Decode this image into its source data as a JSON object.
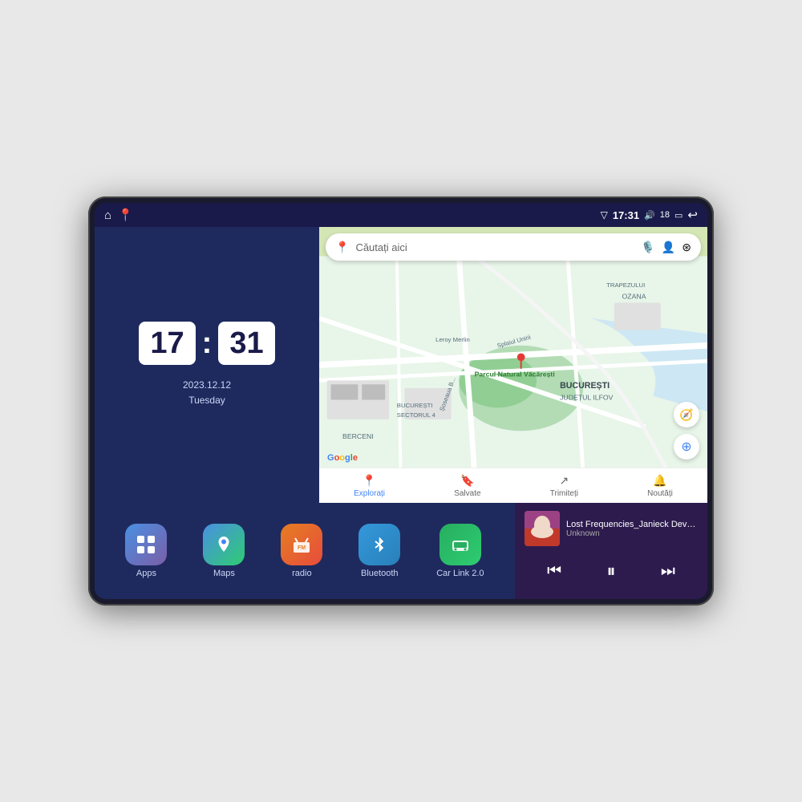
{
  "device": {
    "status_bar": {
      "left_icons": [
        "home-icon",
        "maps-pin-icon"
      ],
      "time": "17:31",
      "volume_icon": "volume-icon",
      "volume_level": "18",
      "battery_icon": "battery-icon",
      "back_icon": "back-icon",
      "signal_icon": "signal-icon"
    },
    "clock": {
      "hours": "17",
      "minutes": "31",
      "date": "2023.12.12",
      "day": "Tuesday"
    },
    "map": {
      "search_placeholder": "Căutați aici",
      "nav_items": [
        {
          "label": "Explorați",
          "icon": "explore-icon",
          "active": true
        },
        {
          "label": "Salvate",
          "icon": "bookmark-icon",
          "active": false
        },
        {
          "label": "Trimiteți",
          "icon": "send-icon",
          "active": false
        },
        {
          "label": "Noutăți",
          "icon": "bell-icon",
          "active": false
        }
      ],
      "google_label": "Google"
    },
    "apps": [
      {
        "id": "apps",
        "label": "Apps",
        "icon": "apps-icon",
        "icon_class": "icon-apps",
        "symbol": "⊞"
      },
      {
        "id": "maps",
        "label": "Maps",
        "icon": "maps-icon",
        "icon_class": "icon-maps",
        "symbol": "📍"
      },
      {
        "id": "radio",
        "label": "radio",
        "icon": "radio-icon",
        "icon_class": "icon-radio",
        "symbol": "📻"
      },
      {
        "id": "bluetooth",
        "label": "Bluetooth",
        "icon": "bluetooth-icon",
        "icon_class": "icon-bluetooth",
        "symbol": "🔵"
      },
      {
        "id": "carlink",
        "label": "Car Link 2.0",
        "icon": "carlink-icon",
        "icon_class": "icon-carlink",
        "symbol": "🚗"
      }
    ],
    "music": {
      "title": "Lost Frequencies_Janieck Devy-...",
      "artist": "Unknown",
      "prev_label": "⏮",
      "play_label": "⏸",
      "next_label": "⏭"
    }
  }
}
